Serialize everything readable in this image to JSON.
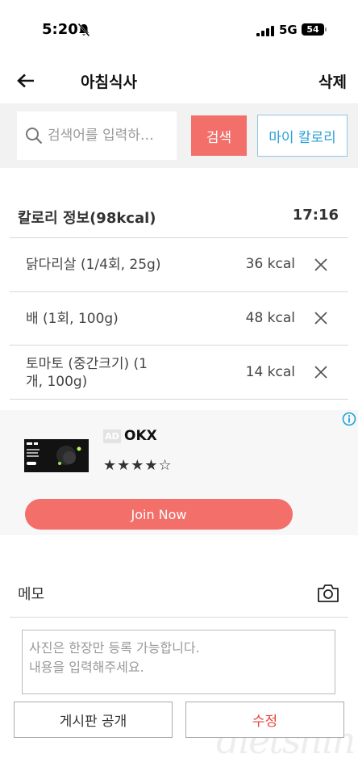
{
  "status_bar": {
    "time": "5:20",
    "network": "5G",
    "battery": "54"
  },
  "header": {
    "title": "아침식사",
    "delete_label": "삭제"
  },
  "search": {
    "placeholder": "검색어를 입력하…",
    "button_label": "검색",
    "my_calorie_label": "마이 칼로리"
  },
  "calorie_info": {
    "title": "칼로리 정보(98kcal)",
    "time": "17:16",
    "items": [
      {
        "name": "닭다리살 (1/4회, 25g)",
        "kcal": "36 kcal"
      },
      {
        "name": "배 (1회, 100g)",
        "kcal": "48 kcal"
      },
      {
        "name_line1": "토마토 (중간크기) (1",
        "name_line2": "개, 100g)",
        "kcal": "14 kcal"
      }
    ]
  },
  "ad": {
    "badge": "AD",
    "name": "OKX",
    "rating": "★★★★☆",
    "rating_value": 4,
    "cta_label": "Join Now"
  },
  "memo": {
    "label": "메모",
    "placeholder": "사진은 한장만 등록 가능합니다.\n내용을 입력해주세요."
  },
  "bottom": {
    "publish_label": "게시판 공개",
    "edit_label": "수정",
    "watermark": "dietshin.com"
  },
  "colors": {
    "accent": "#f26f6a",
    "link_blue": "#29a0d6",
    "edit_red": "#e8433c"
  }
}
